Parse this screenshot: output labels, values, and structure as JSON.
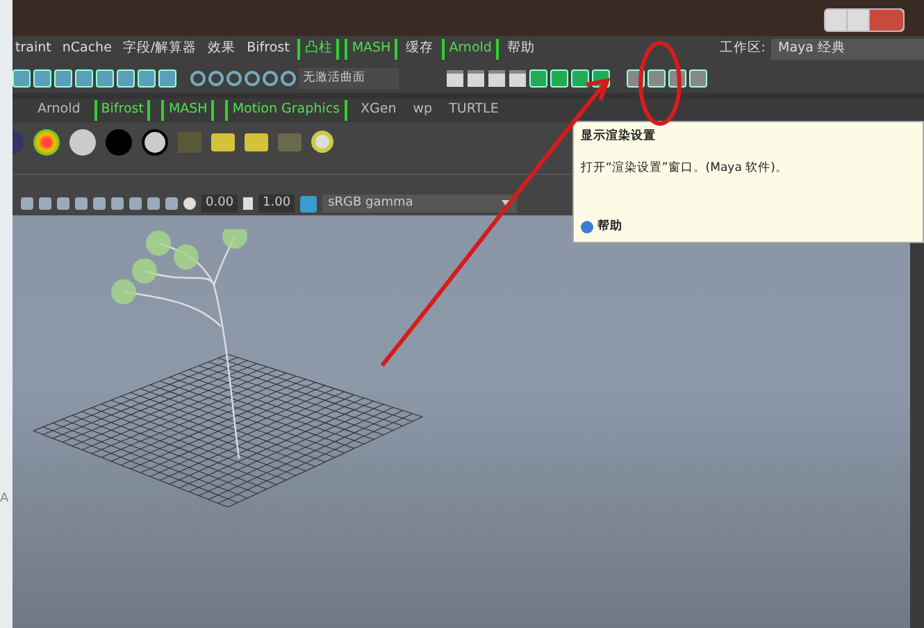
{
  "menu": [
    {
      "label": "traint",
      "kind": "plain"
    },
    {
      "label": "nCache",
      "kind": "plain"
    },
    {
      "label": "字段/解算器",
      "kind": "plain"
    },
    {
      "label": "效果",
      "kind": "plain"
    },
    {
      "label": "Bifrost",
      "kind": "plain"
    },
    {
      "label": "凸柱",
      "kind": "bracketed"
    },
    {
      "label": "MASH",
      "kind": "bracketed"
    },
    {
      "label": "缓存",
      "kind": "plain"
    },
    {
      "label": "Arnold",
      "kind": "bracketed"
    },
    {
      "label": "帮助",
      "kind": "plain"
    }
  ],
  "workspace": {
    "label": "工作区:",
    "value": "Maya 经典"
  },
  "toolbar": {
    "surface_field": "无激活曲面"
  },
  "shelf_tabs": [
    {
      "label": "Arnold",
      "kind": "plain"
    },
    {
      "label": "Bifrost",
      "kind": "bracketed"
    },
    {
      "label": "MASH",
      "kind": "bracketed"
    },
    {
      "label": "Motion Graphics",
      "kind": "bracketed"
    },
    {
      "label": "XGen",
      "kind": "plain"
    },
    {
      "label": "wp",
      "kind": "plain"
    },
    {
      "label": "TURTLE",
      "kind": "plain"
    }
  ],
  "viewport_toolbar": {
    "exposure": "0.00",
    "gamma": "1.00",
    "color_space": "sRGB gamma"
  },
  "tooltip": {
    "title": "显示渲染设置",
    "body": "打开“渲染设置”窗口。(Maya 软件)。",
    "help": "帮助"
  },
  "left_edge_text": "A"
}
